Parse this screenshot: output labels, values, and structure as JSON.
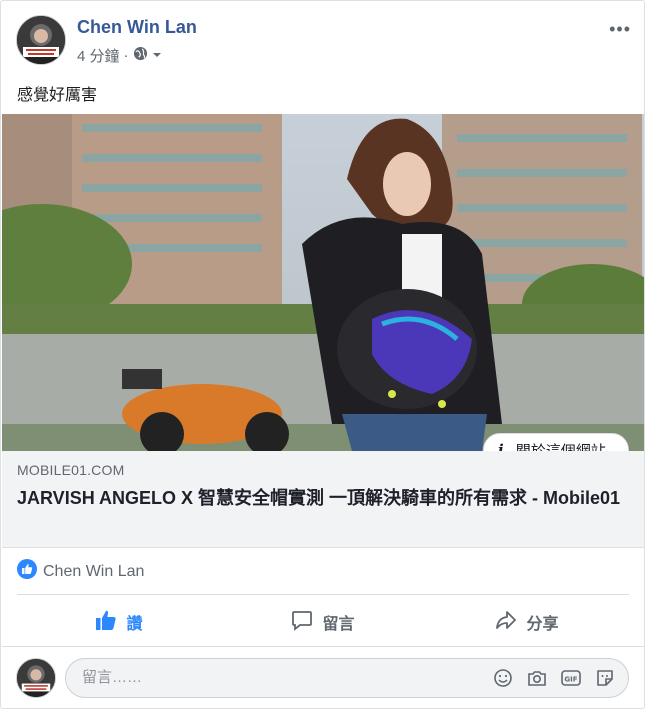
{
  "post": {
    "author": "Chen Win Lan",
    "time": "4 分鐘",
    "dot": "·",
    "privacy_icon": "globe-icon",
    "text": "感覺好厲害",
    "more_label": "•••"
  },
  "link_preview": {
    "domain": "MOBILE01.COM",
    "title": "JARVISH ANGELO X 智慧安全帽實測 一頂解決騎車的所有需求 - Mobile01",
    "about_label": "關於這個網站",
    "about_icon": "info-icon"
  },
  "reactions": {
    "icon": "like-reaction-icon",
    "names": "Chen Win Lan"
  },
  "actions": [
    {
      "label": "讚",
      "icon": "thumbs-up-icon"
    },
    {
      "label": "留言",
      "icon": "comment-icon"
    },
    {
      "label": "分享",
      "icon": "share-icon"
    }
  ],
  "comment": {
    "placeholder": "留言……",
    "icons": [
      "emoji-icon",
      "camera-icon",
      "gif-icon",
      "sticker-icon"
    ]
  },
  "colors": {
    "author": "#385898",
    "like_active": "#2d88ff",
    "link_bg": "#f2f3f5"
  }
}
